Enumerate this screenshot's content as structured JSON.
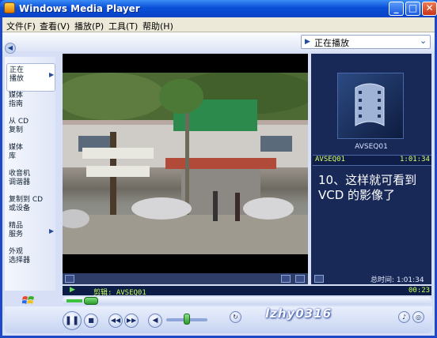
{
  "window": {
    "title": "Windows Media Player"
  },
  "menu": [
    "文件(F)",
    "查看(V)",
    "播放(P)",
    "工具(T)",
    "帮助(H)"
  ],
  "now_playing_dropdown": {
    "label": "正在播放",
    "icon": "now-playing-icon",
    "chevron": "chevron-down-icon"
  },
  "nav": [
    {
      "label": "正在\n播放",
      "selected": true,
      "has_arrow": true
    },
    {
      "label": "媒体\n指南",
      "selected": false,
      "has_arrow": false
    },
    {
      "label": "从 CD\n复制",
      "selected": false,
      "has_arrow": false
    },
    {
      "label": "媒体\n库",
      "selected": false,
      "has_arrow": false
    },
    {
      "label": "收音机\n调谐器",
      "selected": false,
      "has_arrow": false
    },
    {
      "label": "复制到 CD\n或设备",
      "selected": false,
      "has_arrow": false
    },
    {
      "label": "精品\n服务",
      "selected": false,
      "has_arrow": true
    },
    {
      "label": "外观\n选择器",
      "selected": false,
      "has_arrow": false
    }
  ],
  "playlist": {
    "art_label": "AVSEQ01",
    "item_name": "AVSEQ01",
    "item_time": "1:01:34"
  },
  "caption": "10、这样就可看到 VCD 的影像了",
  "total_time": "总时间: 1:01:34",
  "status": {
    "clip_text": "剪辑: AVSEQ01",
    "elapsed": "00:23"
  },
  "seek_progress": 0.006,
  "volume_level": 0.45,
  "watermark": "lzhy0316",
  "colors": {
    "title_bar": "#0a4fd8",
    "status_text": "#c9ff5a",
    "accent_green": "#3cc23c"
  }
}
